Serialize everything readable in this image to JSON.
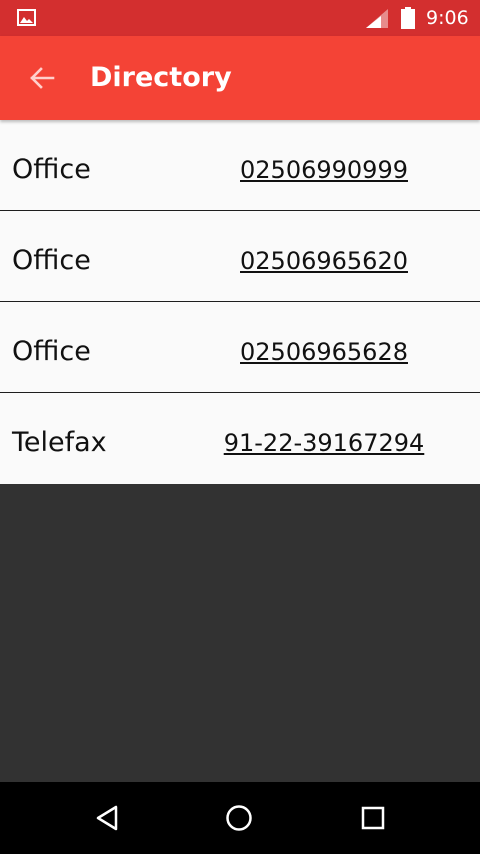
{
  "status_bar": {
    "time": "9:06",
    "icons": [
      "gallery-icon",
      "signal-icon",
      "battery-icon"
    ],
    "color": "#d32f2f"
  },
  "app_bar": {
    "title": "Directory",
    "back_icon": "arrow-back-icon",
    "color": "#f44336"
  },
  "entries": [
    {
      "label": "Office",
      "number": "02506990999"
    },
    {
      "label": "Office",
      "number": "02506965620"
    },
    {
      "label": "Office",
      "number": "02506965628"
    },
    {
      "label": "Telefax",
      "number": "91-22-39167294"
    }
  ],
  "nav_bar": {
    "icons": [
      "back-triangle-icon",
      "home-circle-icon",
      "recents-square-icon"
    ]
  },
  "colors": {
    "list_background": "#fafafa",
    "screen_background": "#323232",
    "divider": "#1e1e1e"
  }
}
